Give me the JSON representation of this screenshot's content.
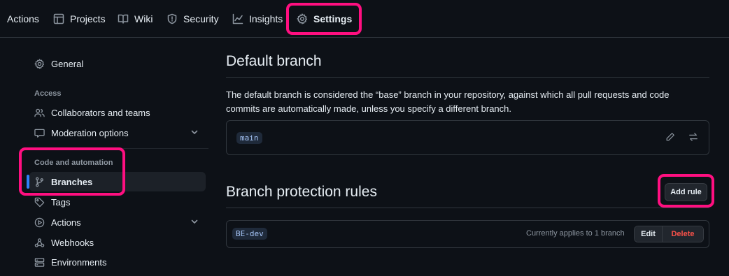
{
  "topnav": {
    "tabs": [
      {
        "label": "Actions",
        "icon": "play-icon"
      },
      {
        "label": "Projects",
        "icon": "table-icon"
      },
      {
        "label": "Wiki",
        "icon": "book-icon"
      },
      {
        "label": "Security",
        "icon": "shield-icon"
      },
      {
        "label": "Insights",
        "icon": "graph-icon"
      },
      {
        "label": "Settings",
        "icon": "gear-icon",
        "active": true
      }
    ]
  },
  "sidebar": {
    "general": "General",
    "access_heading": "Access",
    "access_items": [
      {
        "label": "Collaborators and teams",
        "icon": "people-icon"
      },
      {
        "label": "Moderation options",
        "icon": "comment-icon",
        "expandable": true
      }
    ],
    "code_heading": "Code and automation",
    "code_items": [
      {
        "label": "Branches",
        "icon": "branch-icon",
        "selected": true
      },
      {
        "label": "Tags",
        "icon": "tag-icon"
      },
      {
        "label": "Actions",
        "icon": "play-icon",
        "expandable": true
      },
      {
        "label": "Webhooks",
        "icon": "webhook-icon"
      },
      {
        "label": "Environments",
        "icon": "server-icon"
      }
    ]
  },
  "main": {
    "default_branch": {
      "title": "Default branch",
      "description": "The default branch is considered the “base” branch in your repository, against which all pull requests and code commits are automatically made, unless you specify a different branch.",
      "branch": "main"
    },
    "protection": {
      "title": "Branch protection rules",
      "add_rule": "Add rule",
      "rules": [
        {
          "name": "BE-dev",
          "applies": "Currently applies to 1 branch",
          "edit": "Edit",
          "delete": "Delete"
        }
      ]
    }
  },
  "colors": {
    "background": "#0d1117",
    "highlight": "#ff0f80",
    "danger": "#f85149",
    "accent": "#2f81f7"
  }
}
